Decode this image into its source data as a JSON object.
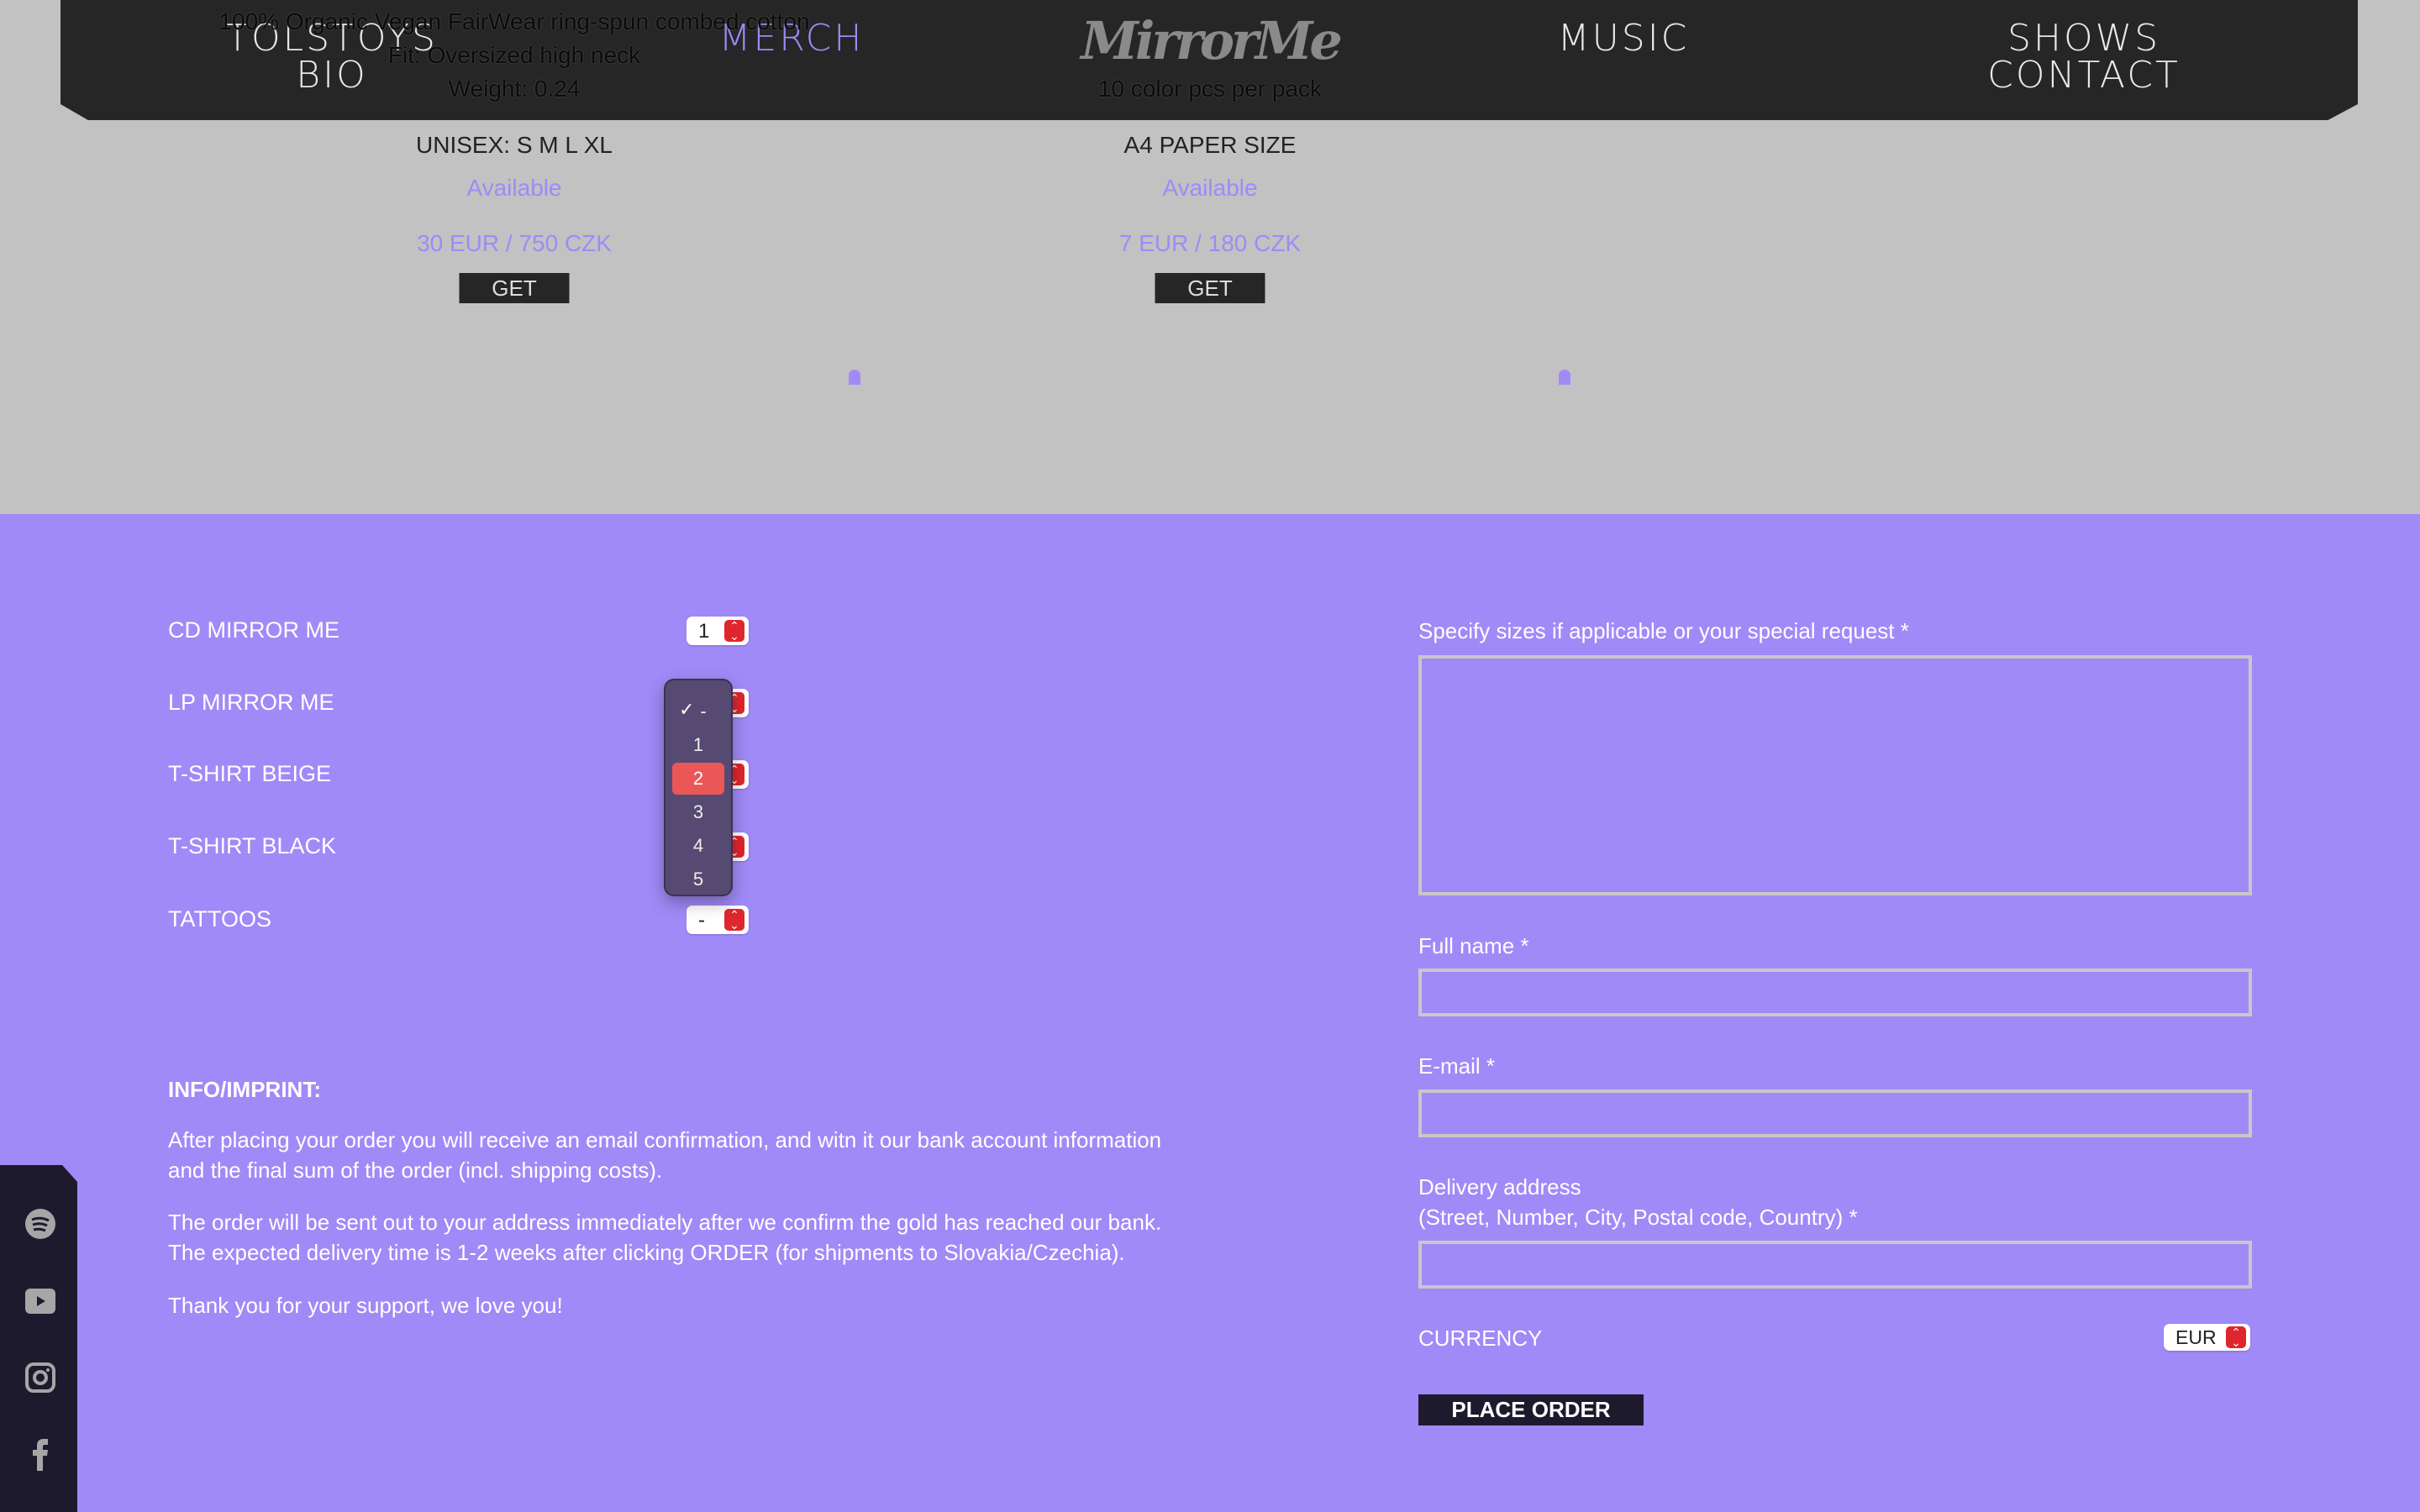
{
  "nav": {
    "items": [
      {
        "label": "TOLSTOYS"
      },
      {
        "label": "BIO"
      },
      {
        "label": "MERCH",
        "active": true
      },
      {
        "label": "MUSIC"
      },
      {
        "label": "SHOWS"
      },
      {
        "label": "CONTACT"
      }
    ],
    "logo": "MirrorMe"
  },
  "products": [
    {
      "details": [
        "100% Organic Vegan FairWear ring-spun combed cotton",
        "Fit: Oversized high neck",
        "Weight: 0.24"
      ],
      "size": "UNISEX: S M L XL",
      "status": "Available",
      "price": "30 EUR / 750 CZK",
      "button": "GET"
    },
    {
      "details": [
        "",
        "",
        "10 color pcs per pack"
      ],
      "size": "A4 PAPER SIZE",
      "status": "Available",
      "price": "7 EUR / 180 CZK",
      "button": "GET"
    }
  ],
  "order": {
    "items": [
      {
        "label": "CD MIRROR ME",
        "value": "1"
      },
      {
        "label": "LP MIRROR ME",
        "value": "-"
      },
      {
        "label": "T-SHIRT BEIGE",
        "value": "-"
      },
      {
        "label": "T-SHIRT BLACK",
        "value": "-"
      },
      {
        "label": "TATTOOS",
        "value": "-"
      }
    ],
    "dropdown": {
      "options": [
        "-",
        "1",
        "2",
        "3",
        "4",
        "5"
      ],
      "checked": "-",
      "highlighted": "2"
    }
  },
  "info": {
    "title": "INFO/IMPRINT:",
    "p1a": "After placing your order you will receive an email confirmation, and witn it our bank account information",
    "p1b": "and the final sum of the order (incl. shipping costs).",
    "p2a": "The order will be sent out to your address immediately after we confirm the gold has reached our bank.",
    "p2b": "The expected delivery time is 1-2 weeks after clicking ORDER (for shipments to Slovakia/Czechia).",
    "p3": "Thank you for your support, we love you!"
  },
  "form": {
    "request_label": "Specify sizes if applicable or your special request",
    "name_label": "Full name",
    "email_label": "E-mail",
    "address_label1": "Delivery address",
    "address_label2": "(Street, Number, City, Postal code, Country)",
    "required": "*",
    "currency_label": "CURRENCY",
    "currency_value": "EUR",
    "submit": "PLACE ORDER"
  },
  "social": [
    "spotify-icon",
    "youtube-icon",
    "instagram-icon",
    "facebook-icon"
  ],
  "colors": {
    "accent": "#a08af7",
    "nav": "#262626",
    "select": "#e0262d",
    "highlight": "#eb5757"
  }
}
